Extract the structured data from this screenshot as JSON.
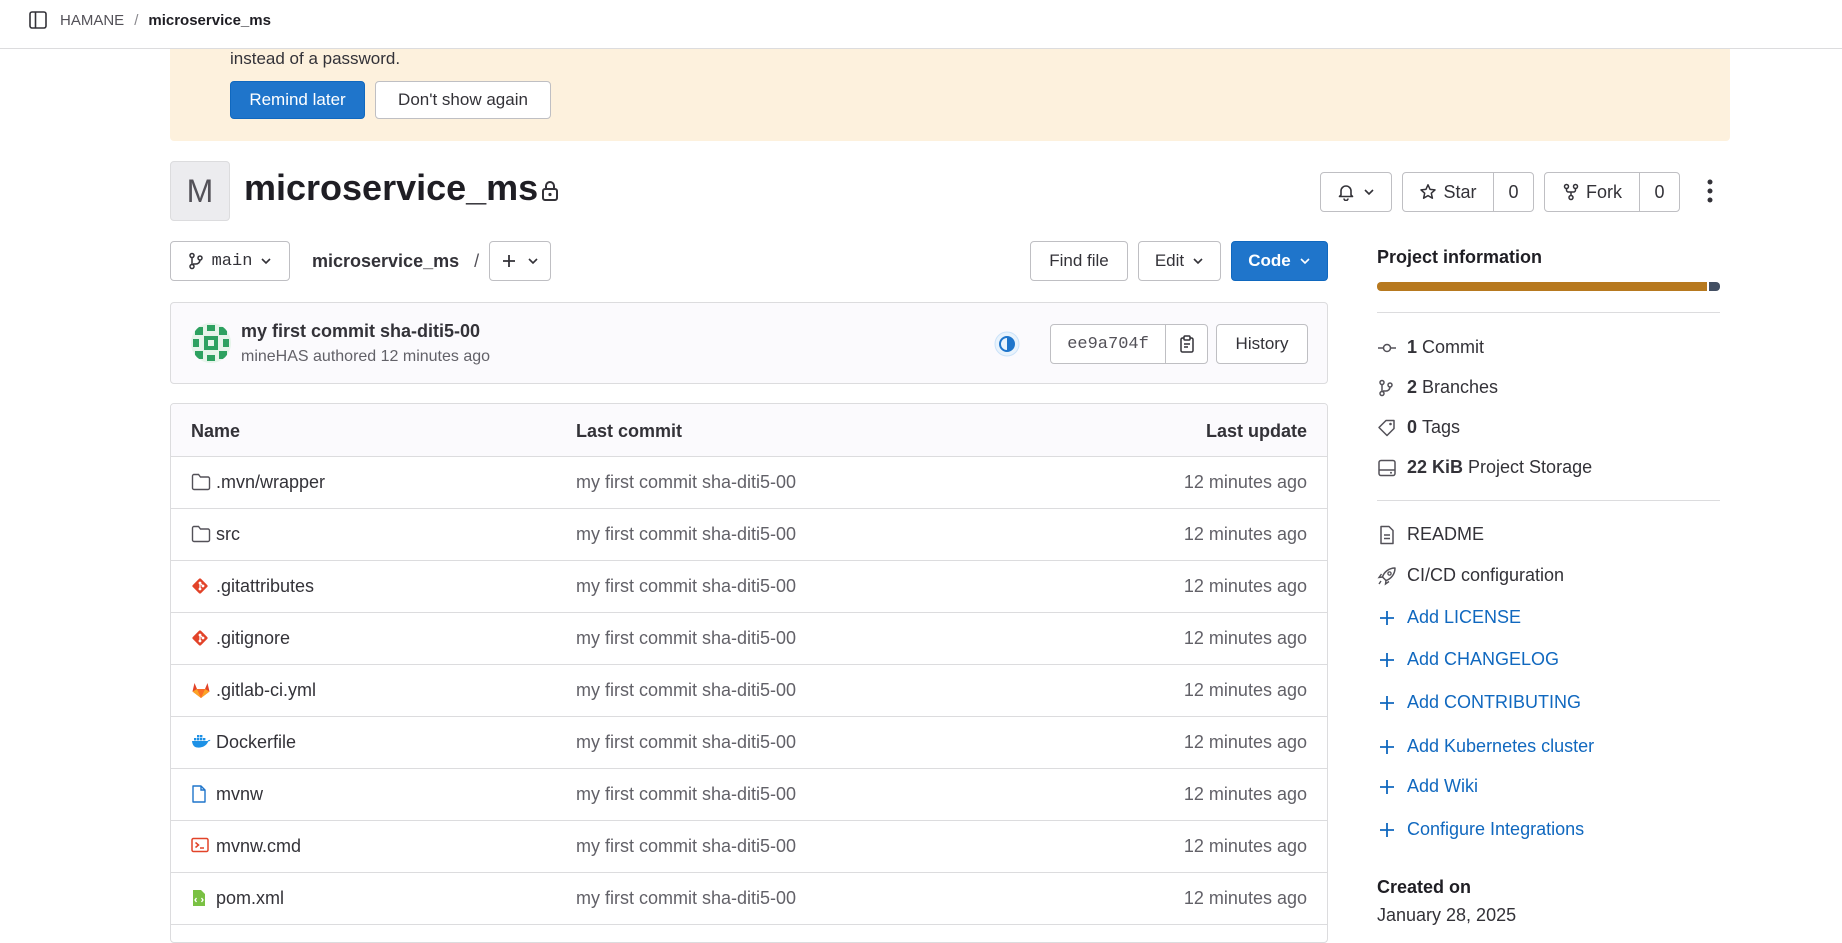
{
  "breadcrumb": {
    "group": "HAMANE",
    "project": "microservice_ms"
  },
  "banner": {
    "text": "instead of a password.",
    "remind_label": "Remind later",
    "dismiss_label": "Don't show again"
  },
  "project": {
    "initial": "M",
    "name": "microservice_ms"
  },
  "actions": {
    "star_label": "Star",
    "star_count": "0",
    "fork_label": "Fork",
    "fork_count": "0"
  },
  "toolbar": {
    "branch": "main",
    "path": "microservice_ms",
    "path_sep": "/",
    "find_file_label": "Find file",
    "edit_label": "Edit",
    "code_label": "Code"
  },
  "commit": {
    "title": "my first commit sha-diti5-00",
    "meta": "mineHAS authored 12 minutes ago",
    "sha": "ee9a704f",
    "history_label": "History"
  },
  "table": {
    "headers": {
      "name": "Name",
      "last_commit": "Last commit",
      "last_update": "Last update"
    },
    "rows": [
      {
        "name": ".mvn/wrapper",
        "icon": "folder-icon",
        "commit": "my first commit sha-diti5-00",
        "updated": "12 minutes ago"
      },
      {
        "name": "src",
        "icon": "folder-icon",
        "commit": "my first commit sha-diti5-00",
        "updated": "12 minutes ago"
      },
      {
        "name": ".gitattributes",
        "icon": "git-icon",
        "commit": "my first commit sha-diti5-00",
        "updated": "12 minutes ago"
      },
      {
        "name": ".gitignore",
        "icon": "git-icon",
        "commit": "my first commit sha-diti5-00",
        "updated": "12 minutes ago"
      },
      {
        "name": ".gitlab-ci.yml",
        "icon": "gitlab-icon",
        "commit": "my first commit sha-diti5-00",
        "updated": "12 minutes ago"
      },
      {
        "name": "Dockerfile",
        "icon": "docker-icon",
        "commit": "my first commit sha-diti5-00",
        "updated": "12 minutes ago"
      },
      {
        "name": "mvnw",
        "icon": "file-icon",
        "commit": "my first commit sha-diti5-00",
        "updated": "12 minutes ago"
      },
      {
        "name": "mvnw.cmd",
        "icon": "terminal-icon",
        "commit": "my first commit sha-diti5-00",
        "updated": "12 minutes ago"
      },
      {
        "name": "pom.xml",
        "icon": "xml-icon",
        "commit": "my first commit sha-diti5-00",
        "updated": "12 minutes ago"
      }
    ]
  },
  "sidebar": {
    "title": "Project information",
    "commits": {
      "count": "1",
      "label": "Commit"
    },
    "branches": {
      "count": "2",
      "label": "Branches"
    },
    "tags": {
      "count": "0",
      "label": "Tags"
    },
    "storage": {
      "count": "22 KiB",
      "label": "Project Storage"
    },
    "readme": "README",
    "cicd": "CI/CD configuration",
    "links": [
      "Add LICENSE",
      "Add CHANGELOG",
      "Add CONTRIBUTING",
      "Add Kubernetes cluster",
      "Add Wiki",
      "Configure Integrations"
    ],
    "created_label": "Created on",
    "created_value": "January 28, 2025"
  },
  "colors": {
    "primary": "#1f75cb",
    "link": "#1068bf",
    "banner_bg": "#fdf1dd",
    "storage_bar": "#b7791f"
  }
}
